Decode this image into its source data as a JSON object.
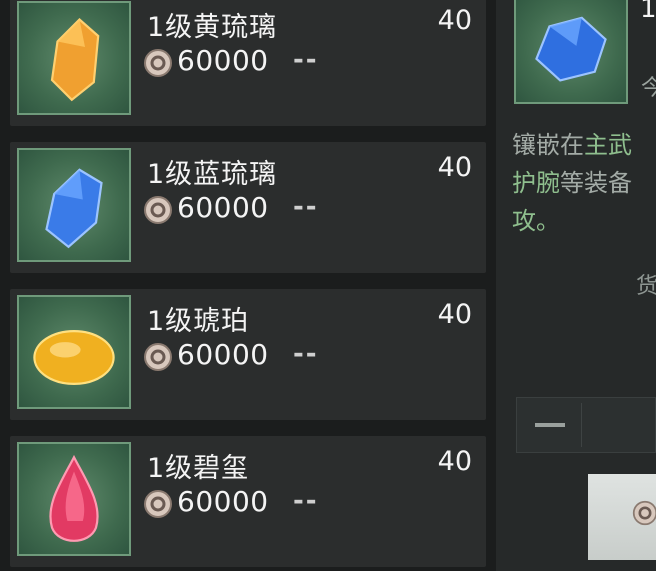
{
  "items": [
    {
      "name": "1级黄琉璃",
      "quantity": "40",
      "price": "60000",
      "stock": "--",
      "gem": "yellow-glass-gem-icon",
      "color": "#f0a030"
    },
    {
      "name": "1级蓝琉璃",
      "quantity": "40",
      "price": "60000",
      "stock": "--",
      "gem": "blue-glass-gem-icon",
      "color": "#3a7be8"
    },
    {
      "name": "1级琥珀",
      "quantity": "40",
      "price": "60000",
      "stock": "--",
      "gem": "amber-gem-icon",
      "color": "#f0b020"
    },
    {
      "name": "1级碧玺",
      "quantity": "40",
      "price": "60000",
      "stock": "--",
      "gem": "tourmaline-gem-icon",
      "color": "#e23a63"
    }
  ],
  "detail": {
    "title_partial": "1",
    "sub_partial": "今",
    "desc_line1_a": "镶嵌在",
    "desc_line1_b": "主武",
    "desc_line2_a": "护腕",
    "desc_line2_b": "等装备",
    "desc_line3": "攻。",
    "currency_label_partial": "货"
  },
  "colors": {
    "highlight": "#8fbf8e",
    "panel": "#2b2d2d",
    "thumb_border": "#6f9a7b"
  }
}
